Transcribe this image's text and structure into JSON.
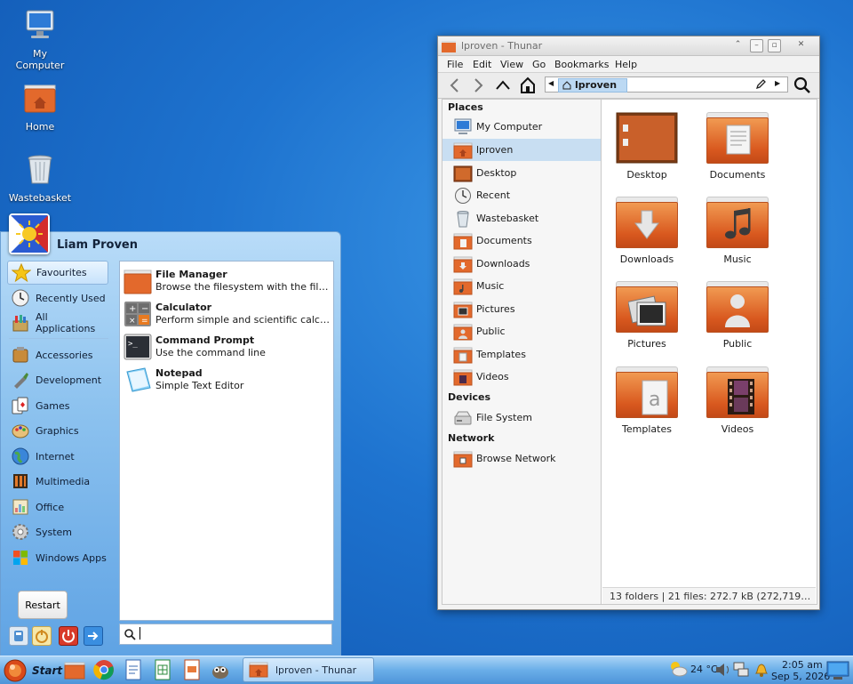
{
  "desktop": {
    "icons": [
      {
        "label": "My Computer"
      },
      {
        "label": "Home"
      },
      {
        "label": "Wastebasket"
      }
    ]
  },
  "start_menu": {
    "user_name": "Liam Proven",
    "categories": [
      {
        "label": "Favourites",
        "icon": "star-icon"
      },
      {
        "label": "Recently Used",
        "icon": "clock-icon"
      },
      {
        "label": "All Applications",
        "icon": "applications-icon"
      },
      {
        "label": "Accessories",
        "icon": "accessories-icon"
      },
      {
        "label": "Development",
        "icon": "development-icon"
      },
      {
        "label": "Games",
        "icon": "games-icon"
      },
      {
        "label": "Graphics",
        "icon": "graphics-icon"
      },
      {
        "label": "Internet",
        "icon": "globe-icon"
      },
      {
        "label": "Multimedia",
        "icon": "multimedia-icon"
      },
      {
        "label": "Office",
        "icon": "office-icon"
      },
      {
        "label": "System",
        "icon": "gear-icon"
      },
      {
        "label": "Windows Apps",
        "icon": "windows-icon"
      }
    ],
    "apps": [
      {
        "name": "File Manager",
        "desc": "Browse the filesystem with the file m...",
        "icon": "folder-icon"
      },
      {
        "name": "Calculator",
        "desc": "Perform simple and scientific calculati...",
        "icon": "calculator-icon"
      },
      {
        "name": "Command Prompt",
        "desc": "Use the command line",
        "icon": "terminal-icon"
      },
      {
        "name": "Notepad",
        "desc": "Simple Text Editor",
        "icon": "notepad-icon"
      }
    ],
    "restart_label": "Restart",
    "search_value": ""
  },
  "thunar": {
    "title": "lproven - Thunar",
    "menu": [
      "File",
      "Edit",
      "View",
      "Go",
      "Bookmarks",
      "Help"
    ],
    "location": "lproven",
    "sidebar": {
      "places_header": "Places",
      "places": [
        "My Computer",
        "lproven",
        "Desktop",
        "Recent",
        "Wastebasket",
        "Documents",
        "Downloads",
        "Music",
        "Pictures",
        "Public",
        "Templates",
        "Videos"
      ],
      "devices_header": "Devices",
      "devices": [
        "File System"
      ],
      "network_header": "Network",
      "network": [
        "Browse Network"
      ]
    },
    "folders": [
      "Desktop",
      "Documents",
      "Downloads",
      "Music",
      "Pictures",
      "Public",
      "Templates",
      "Videos"
    ],
    "status": "13 folders  |  21 files: 272.7 kB (272,719 by..."
  },
  "taskbar": {
    "start_label": "Start",
    "task_label": "lproven - Thunar",
    "weather": "24 °C",
    "time": "2:05 am",
    "date": "Sep 5, 2026"
  },
  "colors": {
    "desktop_blue": "#1e73cf",
    "folder_orange": "#e0682a",
    "selection_blue": "#c8def2"
  }
}
